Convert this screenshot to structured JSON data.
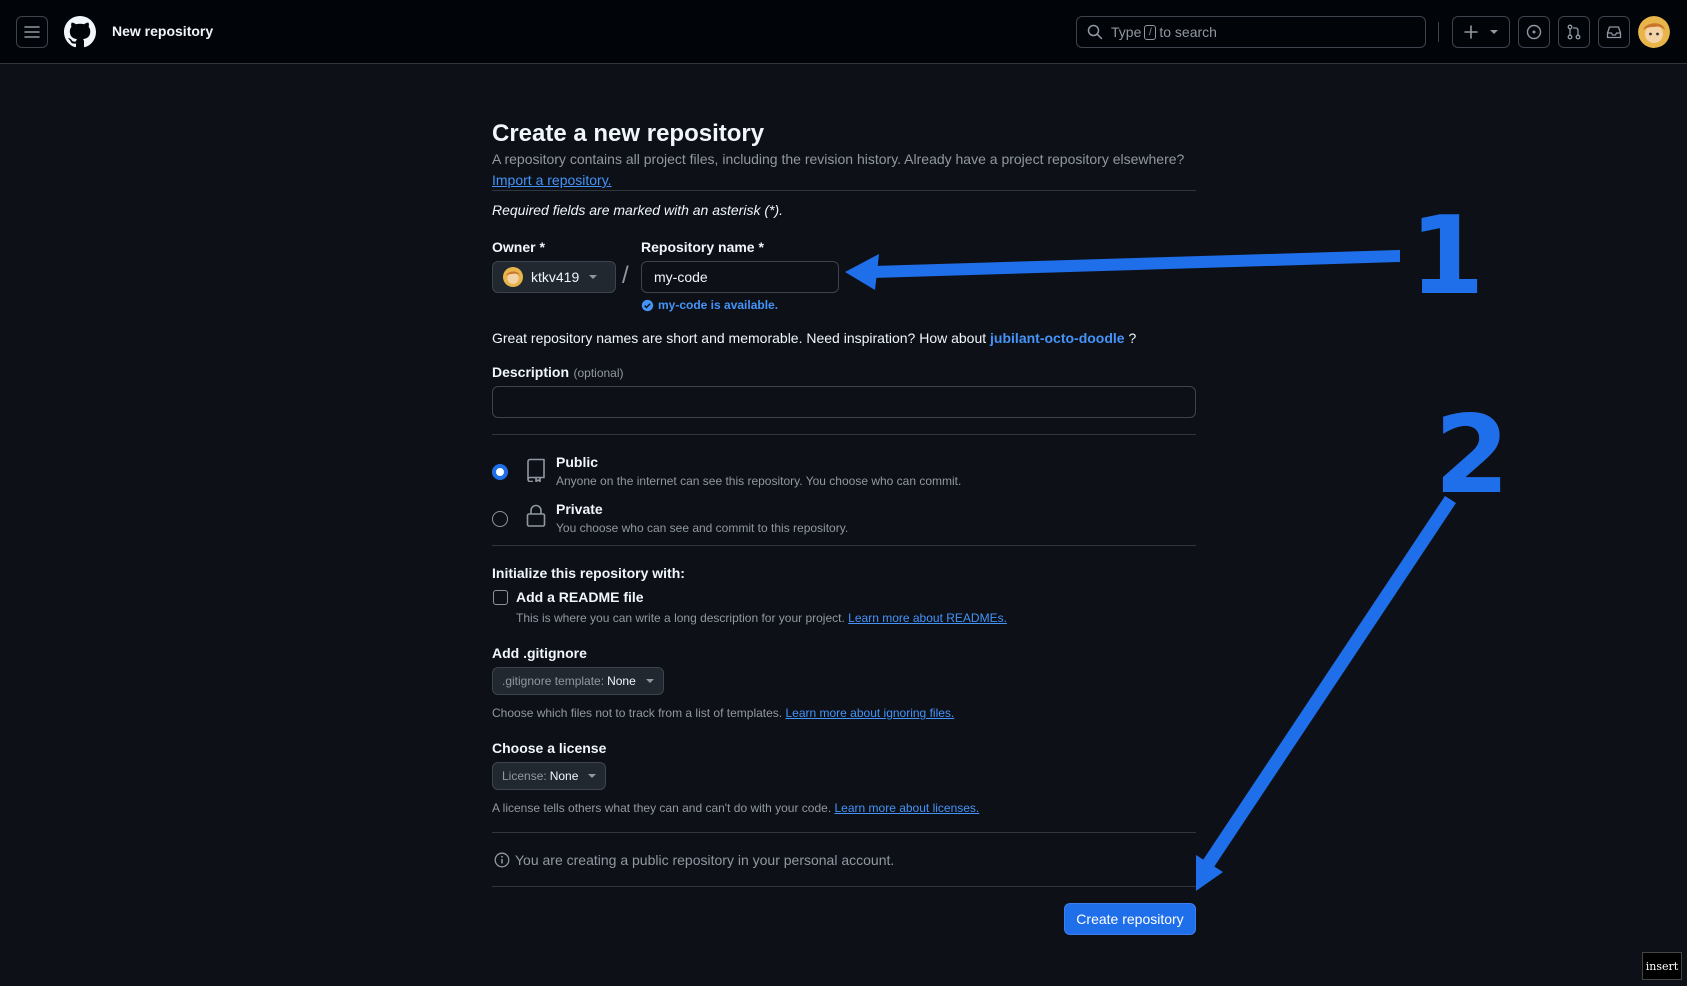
{
  "header": {
    "context_title": "New repository",
    "search": {
      "prefix": "Type",
      "key": "/",
      "suffix": "to search"
    },
    "icons": [
      "hamburger-icon",
      "github-logo-icon",
      "search-icon",
      "plus-icon",
      "issues-icon",
      "pull-request-icon",
      "inbox-icon"
    ]
  },
  "page": {
    "title": "Create a new repository",
    "subtitle": "A repository contains all project files, including the revision history. Already have a project repository elsewhere?",
    "import_link": "Import a repository.",
    "required_note": "Required fields are marked with an asterisk (*)."
  },
  "owner": {
    "label": "Owner *",
    "value": "ktkv419"
  },
  "slash": "/",
  "repo_name": {
    "label": "Repository name *",
    "value": "my-code",
    "availability": "my-code is available."
  },
  "inspiration": {
    "text": "Great repository names are short and memorable. Need inspiration? How about",
    "suggestion": "jubilant-octo-doodle",
    "suffix": "?"
  },
  "description": {
    "label": "Description",
    "optional": "(optional)",
    "value": ""
  },
  "visibility": {
    "public": {
      "title": "Public",
      "desc": "Anyone on the internet can see this repository. You choose who can commit.",
      "selected": true
    },
    "private": {
      "title": "Private",
      "desc": "You choose who can see and commit to this repository.",
      "selected": false
    }
  },
  "initialize": {
    "heading": "Initialize this repository with:",
    "readme": {
      "label": "Add a README file",
      "desc": "This is where you can write a long description for your project.",
      "link": "Learn more about READMEs.",
      "checked": false
    }
  },
  "gitignore": {
    "heading": "Add .gitignore",
    "select_prefix": ".gitignore template:",
    "select_value": "None",
    "desc": "Choose which files not to track from a list of templates.",
    "link": "Learn more about ignoring files."
  },
  "license": {
    "heading": "Choose a license",
    "select_prefix": "License:",
    "select_value": "None",
    "desc": "A license tells others what they can and can't do with your code.",
    "link": "Learn more about licenses."
  },
  "info_note": "You are creating a public repository in your personal account.",
  "create_button": "Create repository",
  "annotations": {
    "step1": "1",
    "step2": "2",
    "color": "#1f6feb"
  },
  "insert_badge": "insert"
}
